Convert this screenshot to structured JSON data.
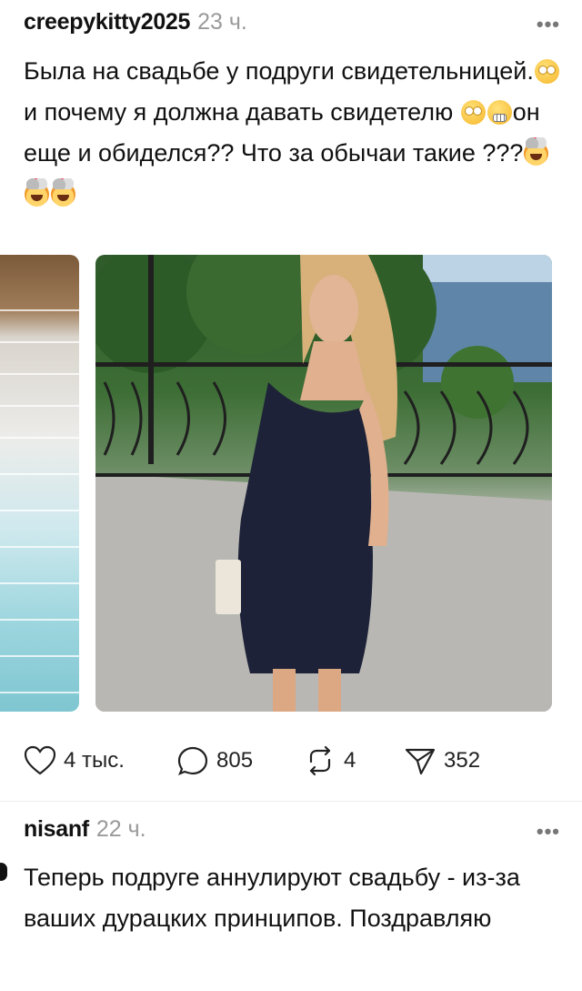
{
  "post": {
    "username": "creepykitty2025",
    "time": "23 ч.",
    "more": "•••",
    "text_1": "Была на свадьбе у подруги свидетельницей.",
    "text_2": "и почему я должна давать свидетелю ",
    "text_3": "он еще и обиделся?? Что за обычаи такие ???",
    "emojis": [
      "face-with-rolling-eyes",
      "face-with-rolling-eyes",
      "grimacing-face",
      "exploding-head",
      "exploding-head",
      "exploding-head"
    ]
  },
  "actions": {
    "likes": "4 тыс.",
    "comments": "805",
    "reposts": "4",
    "shares": "352"
  },
  "comment": {
    "username": "nisanf",
    "time": "22 ч.",
    "more": "•••",
    "text": "Теперь подруге аннулируют свадьбу - из-за ваших дурацких принципов. Поздравляю"
  },
  "colors": {
    "text": "#111111",
    "muted": "#9a9a9a",
    "background": "#ffffff"
  }
}
